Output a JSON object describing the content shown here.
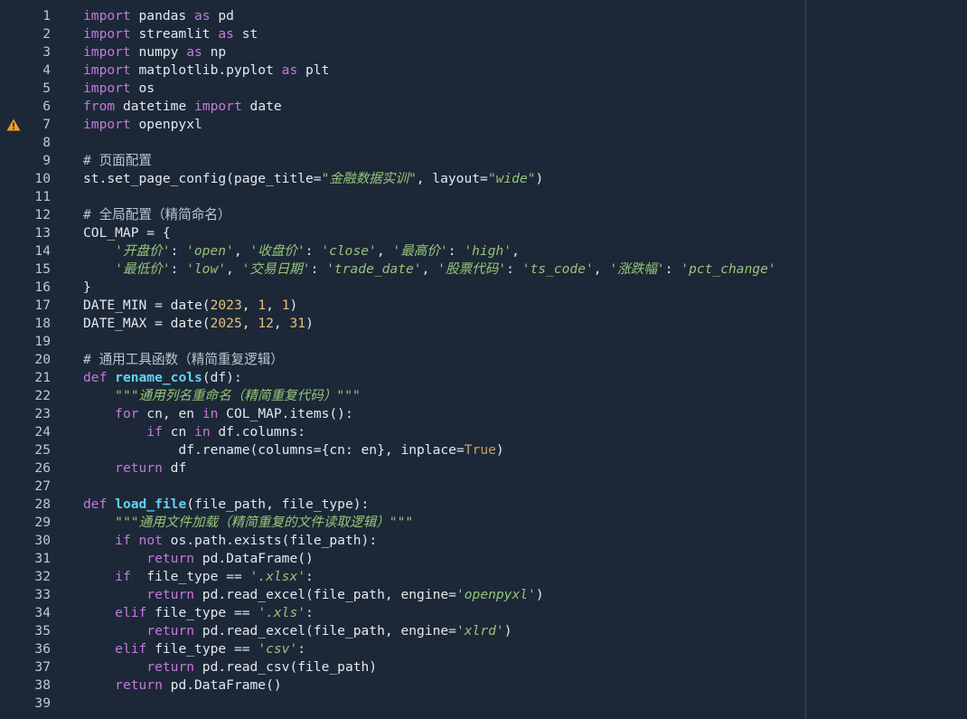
{
  "editor": {
    "colors": {
      "background": "#1c2837",
      "line_number": "#c0c8d2",
      "keyword": "#c678dd",
      "function": "#61d2f3",
      "string": "#98c379",
      "number": "#e5c07b",
      "warning": "#f0a020"
    },
    "warning_line": 7,
    "lines": [
      {
        "n": "1",
        "t": [
          [
            "kw",
            "import"
          ],
          [
            "p",
            " pandas "
          ],
          [
            "kw",
            "as"
          ],
          [
            "p",
            " pd"
          ]
        ]
      },
      {
        "n": "2",
        "t": [
          [
            "kw",
            "import"
          ],
          [
            "p",
            " streamlit "
          ],
          [
            "kw",
            "as"
          ],
          [
            "p",
            " st"
          ]
        ]
      },
      {
        "n": "3",
        "t": [
          [
            "kw",
            "import"
          ],
          [
            "p",
            " numpy "
          ],
          [
            "kw",
            "as"
          ],
          [
            "p",
            " np"
          ]
        ]
      },
      {
        "n": "4",
        "t": [
          [
            "kw",
            "import"
          ],
          [
            "p",
            " matplotlib.pyplot "
          ],
          [
            "kw",
            "as"
          ],
          [
            "p",
            " plt"
          ]
        ]
      },
      {
        "n": "5",
        "t": [
          [
            "kw",
            "import"
          ],
          [
            "p",
            " os"
          ]
        ]
      },
      {
        "n": "6",
        "t": [
          [
            "kw",
            "from"
          ],
          [
            "p",
            " datetime "
          ],
          [
            "kw",
            "import"
          ],
          [
            "p",
            " date"
          ]
        ]
      },
      {
        "n": "7",
        "t": [
          [
            "kw",
            "import"
          ],
          [
            "p",
            " openpyxl"
          ]
        ]
      },
      {
        "n": "8",
        "t": []
      },
      {
        "n": "9",
        "t": [
          [
            "cm",
            "# 页面配置"
          ]
        ]
      },
      {
        "n": "10",
        "t": [
          [
            "p",
            "st.set_page_config(page_title="
          ],
          [
            "str",
            "\"金融数据实训\""
          ],
          [
            "p",
            ", layout="
          ],
          [
            "str",
            "\"wide\""
          ],
          [
            "p",
            ")"
          ]
        ]
      },
      {
        "n": "11",
        "t": []
      },
      {
        "n": "12",
        "t": [
          [
            "cm",
            "# 全局配置（精简命名）"
          ]
        ]
      },
      {
        "n": "13",
        "t": [
          [
            "p",
            "COL_MAP = {"
          ]
        ]
      },
      {
        "n": "14",
        "t": [
          [
            "p",
            "    "
          ],
          [
            "str",
            "'开盘价'"
          ],
          [
            "p",
            ": "
          ],
          [
            "str",
            "'open'"
          ],
          [
            "p",
            ", "
          ],
          [
            "str",
            "'收盘价'"
          ],
          [
            "p",
            ": "
          ],
          [
            "str",
            "'close'"
          ],
          [
            "p",
            ", "
          ],
          [
            "str",
            "'最高价'"
          ],
          [
            "p",
            ": "
          ],
          [
            "str",
            "'high'"
          ],
          [
            "p",
            ","
          ]
        ]
      },
      {
        "n": "15",
        "t": [
          [
            "p",
            "    "
          ],
          [
            "str",
            "'最低价'"
          ],
          [
            "p",
            ": "
          ],
          [
            "str",
            "'low'"
          ],
          [
            "p",
            ", "
          ],
          [
            "str",
            "'交易日期'"
          ],
          [
            "p",
            ": "
          ],
          [
            "str",
            "'trade_date'"
          ],
          [
            "p",
            ", "
          ],
          [
            "str",
            "'股票代码'"
          ],
          [
            "p",
            ": "
          ],
          [
            "str",
            "'ts_code'"
          ],
          [
            "p",
            ", "
          ],
          [
            "str",
            "'涨跌幅'"
          ],
          [
            "p",
            ": "
          ],
          [
            "str",
            "'pct_change'"
          ]
        ]
      },
      {
        "n": "16",
        "t": [
          [
            "p",
            "}"
          ]
        ]
      },
      {
        "n": "17",
        "t": [
          [
            "p",
            "DATE_MIN = date("
          ],
          [
            "num",
            "2023"
          ],
          [
            "p",
            ", "
          ],
          [
            "num",
            "1"
          ],
          [
            "p",
            ", "
          ],
          [
            "num",
            "1"
          ],
          [
            "p",
            ")"
          ]
        ]
      },
      {
        "n": "18",
        "t": [
          [
            "p",
            "DATE_MAX = date("
          ],
          [
            "num",
            "2025"
          ],
          [
            "p",
            ", "
          ],
          [
            "num",
            "12"
          ],
          [
            "p",
            ", "
          ],
          [
            "num",
            "31"
          ],
          [
            "p",
            ")"
          ]
        ]
      },
      {
        "n": "19",
        "t": []
      },
      {
        "n": "20",
        "t": [
          [
            "cm",
            "# 通用工具函数（精简重复逻辑）"
          ]
        ]
      },
      {
        "n": "21",
        "t": [
          [
            "kw",
            "def"
          ],
          [
            "p",
            " "
          ],
          [
            "fn",
            "rename_cols"
          ],
          [
            "p",
            "(df):"
          ]
        ]
      },
      {
        "n": "22",
        "t": [
          [
            "p",
            "    "
          ],
          [
            "str",
            "\"\"\"通用列名重命名（精简重复代码）\"\"\""
          ]
        ]
      },
      {
        "n": "23",
        "t": [
          [
            "p",
            "    "
          ],
          [
            "kw",
            "for"
          ],
          [
            "p",
            " cn, en "
          ],
          [
            "kw",
            "in"
          ],
          [
            "p",
            " COL_MAP.items():"
          ]
        ]
      },
      {
        "n": "24",
        "t": [
          [
            "p",
            "        "
          ],
          [
            "kw",
            "if"
          ],
          [
            "p",
            " cn "
          ],
          [
            "kw",
            "in"
          ],
          [
            "p",
            " df.columns:"
          ]
        ]
      },
      {
        "n": "25",
        "t": [
          [
            "p",
            "            df.rename(columns={cn: en}, inplace="
          ],
          [
            "cst",
            "True"
          ],
          [
            "p",
            ")"
          ]
        ]
      },
      {
        "n": "26",
        "t": [
          [
            "p",
            "    "
          ],
          [
            "kw",
            "return"
          ],
          [
            "p",
            " df"
          ]
        ]
      },
      {
        "n": "27",
        "t": []
      },
      {
        "n": "28",
        "t": [
          [
            "kw",
            "def"
          ],
          [
            "p",
            " "
          ],
          [
            "fn",
            "load_file"
          ],
          [
            "p",
            "(file_path, file_type):"
          ]
        ]
      },
      {
        "n": "29",
        "t": [
          [
            "p",
            "    "
          ],
          [
            "str",
            "\"\"\"通用文件加载（精简重复的文件读取逻辑）\"\"\""
          ]
        ]
      },
      {
        "n": "30",
        "t": [
          [
            "p",
            "    "
          ],
          [
            "kw",
            "if"
          ],
          [
            "p",
            " "
          ],
          [
            "kw",
            "not"
          ],
          [
            "p",
            " os.path.exists(file_path):"
          ]
        ]
      },
      {
        "n": "31",
        "t": [
          [
            "p",
            "        "
          ],
          [
            "kw",
            "return"
          ],
          [
            "p",
            " pd.DataFrame()"
          ]
        ]
      },
      {
        "n": "32",
        "t": [
          [
            "p",
            "    "
          ],
          [
            "kw",
            "if"
          ],
          [
            "p",
            "  file_type == "
          ],
          [
            "str",
            "'.xlsx'"
          ],
          [
            "p",
            ":"
          ]
        ]
      },
      {
        "n": "33",
        "t": [
          [
            "p",
            "        "
          ],
          [
            "kw",
            "return"
          ],
          [
            "p",
            " pd.read_excel(file_path, engine="
          ],
          [
            "str",
            "'openpyxl'"
          ],
          [
            "p",
            ")"
          ]
        ]
      },
      {
        "n": "34",
        "t": [
          [
            "p",
            "    "
          ],
          [
            "kw",
            "elif"
          ],
          [
            "p",
            " file_type == "
          ],
          [
            "str",
            "'.xls'"
          ],
          [
            "p",
            ":"
          ]
        ]
      },
      {
        "n": "35",
        "t": [
          [
            "p",
            "        "
          ],
          [
            "kw",
            "return"
          ],
          [
            "p",
            " pd.read_excel(file_path, engine="
          ],
          [
            "str",
            "'xlrd'"
          ],
          [
            "p",
            ")"
          ]
        ]
      },
      {
        "n": "36",
        "t": [
          [
            "p",
            "    "
          ],
          [
            "kw",
            "elif"
          ],
          [
            "p",
            " file_type == "
          ],
          [
            "str",
            "'csv'"
          ],
          [
            "p",
            ":"
          ]
        ]
      },
      {
        "n": "37",
        "t": [
          [
            "p",
            "        "
          ],
          [
            "kw",
            "return"
          ],
          [
            "p",
            " pd.read_csv(file_path)"
          ]
        ]
      },
      {
        "n": "38",
        "t": [
          [
            "p",
            "    "
          ],
          [
            "kw",
            "return"
          ],
          [
            "p",
            " pd.DataFrame()"
          ]
        ]
      },
      {
        "n": "39",
        "t": []
      }
    ]
  }
}
